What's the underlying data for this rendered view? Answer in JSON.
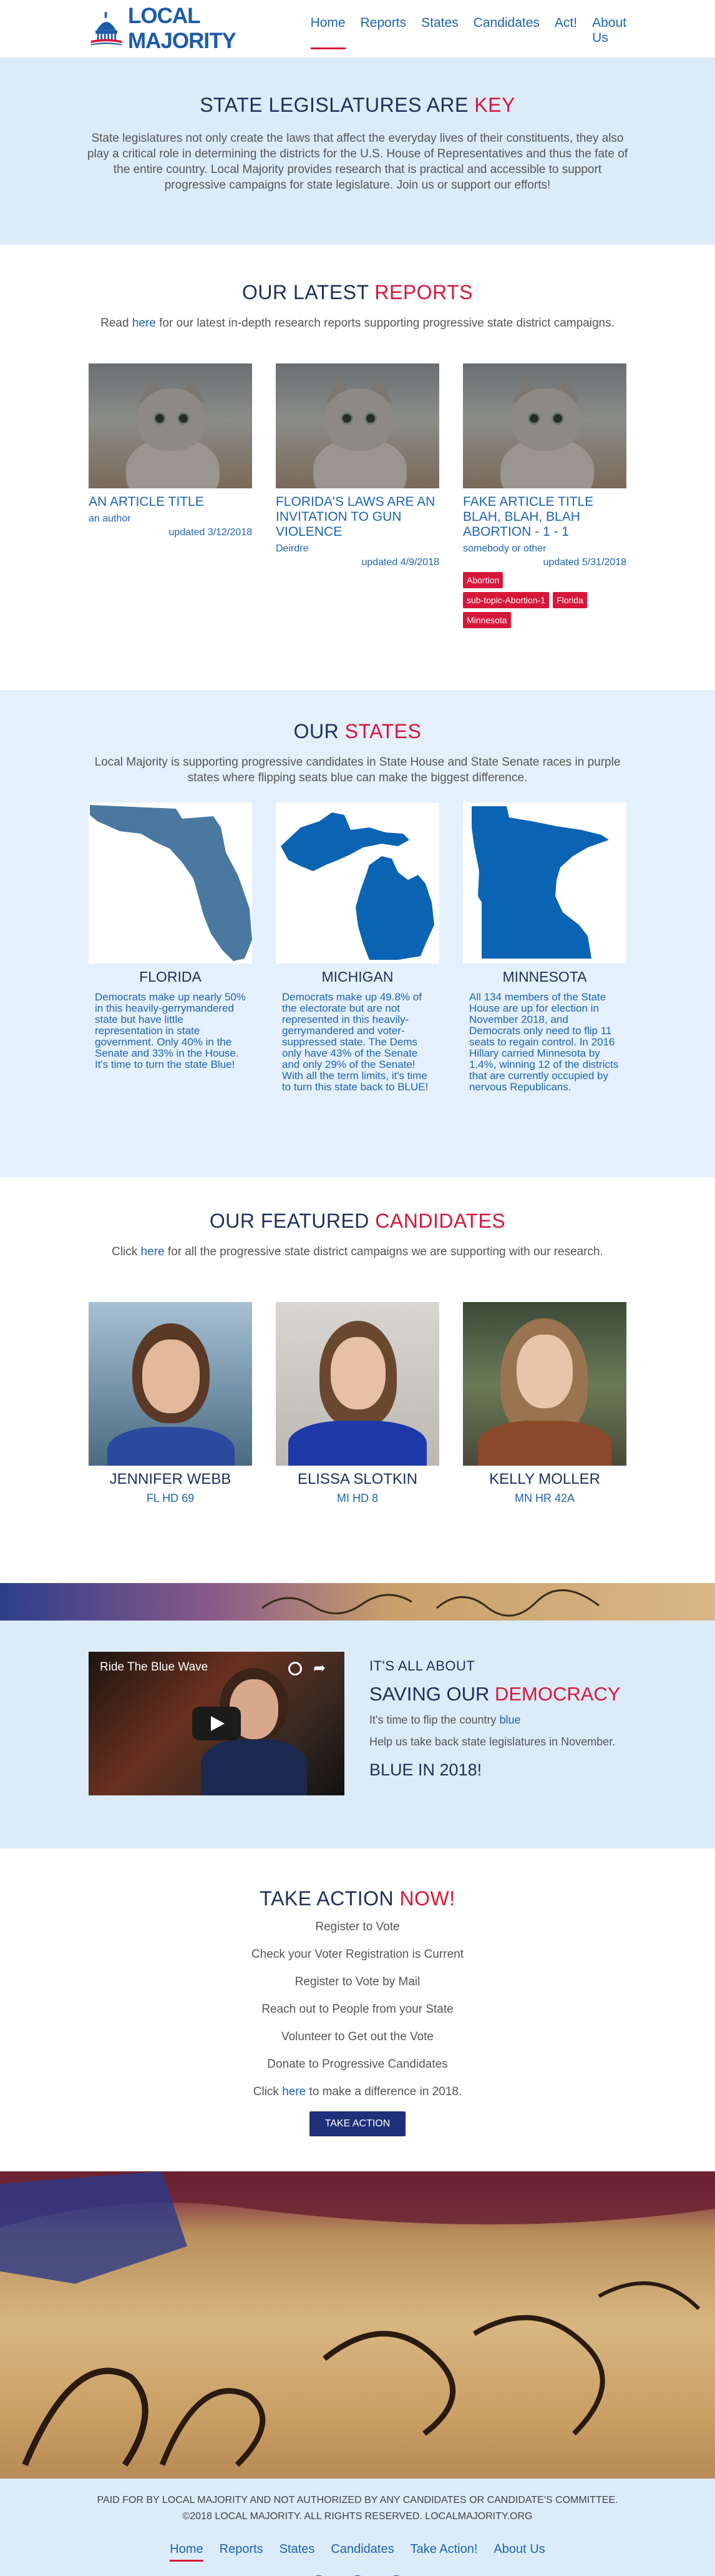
{
  "brand": {
    "logo_text": "LOCAL MAJORITY"
  },
  "nav": {
    "items": [
      "Home",
      "Reports",
      "States",
      "Candidates",
      "Act!",
      "About Us"
    ],
    "active": "Home"
  },
  "hero": {
    "title_a": "STATE LEGISLATURES ARE ",
    "title_b": "KEY",
    "body": "State legislatures not only create the laws that affect the everyday lives of their constituents, they also play a critical role in determining the districts for the U.S. House of Representatives and thus the fate of the entire country. Local Majority provides research that is practical and accessible to support progressive campaigns for state legislature. Join us or support our efforts!"
  },
  "reports": {
    "title_a": "OUR LATEST ",
    "title_b": "REPORTS",
    "lead_a": "Read ",
    "lead_link": "here",
    "lead_b": " for our latest in-depth research reports supporting progressive state district campaigns.",
    "items": [
      {
        "title": "AN ARTICLE TITLE",
        "author": "an author",
        "date": "updated 3/12/2018",
        "tags": []
      },
      {
        "title": "FLORIDA'S LAWS ARE AN INVITATION TO GUN VIOLENCE",
        "author": "Deirdre",
        "date": "updated 4/9/2018",
        "tags": []
      },
      {
        "title": "FAKE ARTICLE TITLE BLAH, BLAH, BLAH ABORTION - 1 - 1",
        "author": "somebody or other",
        "date": "updated 5/31/2018",
        "tags": [
          "Abortion",
          "sub-topic-Abortion-1",
          "Florida",
          "Minnesota"
        ]
      }
    ]
  },
  "states": {
    "title_a": "OUR ",
    "title_b": "STATES",
    "lead": "Local Majority is supporting progressive candidates in State House and State Senate races in purple states where flipping seats blue can make the biggest difference.",
    "items": [
      {
        "name": "FLORIDA",
        "text": "Democrats make up nearly 50% in this heavily-gerrymandered state but have little representation in state government. Only 40% in the Senate and 33% in the House. It's time to turn the state Blue!"
      },
      {
        "name": "MICHIGAN",
        "text": "Democrats make up 49.8% of the electorate but are not represented in this heavily-gerrymandered and voter-suppressed state. The Dems only have 43% of the Senate and only 29% of the Senate! With all the term limits, it's time to turn this state back to BLUE!"
      },
      {
        "name": "MINNESOTA",
        "text": "All 134 members of the State House are up for election in November 2018, and Democrats only need to flip 11 seats to regain control. In 2016 Hillary carried Minnesota by 1.4%, winning 12 of the districts that are currently occupied by nervous Republicans."
      }
    ]
  },
  "candidates": {
    "title_a": "OUR FEATURED ",
    "title_b": "CANDIDATES",
    "lead_a": "Click ",
    "lead_link": "here",
    "lead_b": " for all the progressive state district campaigns we are supporting with our research.",
    "items": [
      {
        "name": "JENNIFER WEBB",
        "district": "FL HD 69"
      },
      {
        "name": "ELISSA SLOTKIN",
        "district": "MI HD 8"
      },
      {
        "name": "KELLY MOLLER",
        "district": "MN HR 42A"
      }
    ]
  },
  "video": {
    "video_title": "Ride The Blue Wave",
    "kicker": "IT'S ALL ABOUT",
    "heading_a": "SAVING OUR ",
    "heading_b": "DEMOCRACY",
    "line1_a": "It's time to flip the country ",
    "line1_b": "blue",
    "line2": "Help us take back state legislatures in November.",
    "tagline": "BLUE IN 2018!"
  },
  "action": {
    "title_a": "TAKE ACTION ",
    "title_b": "NOW!",
    "items": [
      "Register to Vote",
      "Check your Voter Registration is Current",
      "Register to Vote by Mail",
      "Reach out to People from your State",
      "Volunteer to Get out the Vote",
      "Donate to Progressive Candidates"
    ],
    "cta_a": "Click ",
    "cta_link": "here",
    "cta_b": " to make a difference in 2018.",
    "button": "TAKE ACTION"
  },
  "footer": {
    "disclaimer": "PAID FOR BY LOCAL MAJORITY AND NOT AUTHORIZED BY ANY CANDIDATES OR CANDIDATE'S COMMITTEE.",
    "copyright": "©2018 LOCAL MAJORITY. ALL RIGHTS RESERVED. LOCALMAJORITY.ORG",
    "links": [
      "Home",
      "Reports",
      "States",
      "Candidates",
      "Take Action!",
      "About Us"
    ],
    "social": [
      "facebook-icon",
      "twitter-icon",
      "instagram-icon"
    ]
  },
  "colors": {
    "accent_red": "#d6173a",
    "navy": "#1f2f5a",
    "link_blue": "#1d64b0",
    "light_bg": "#dcebf8"
  }
}
